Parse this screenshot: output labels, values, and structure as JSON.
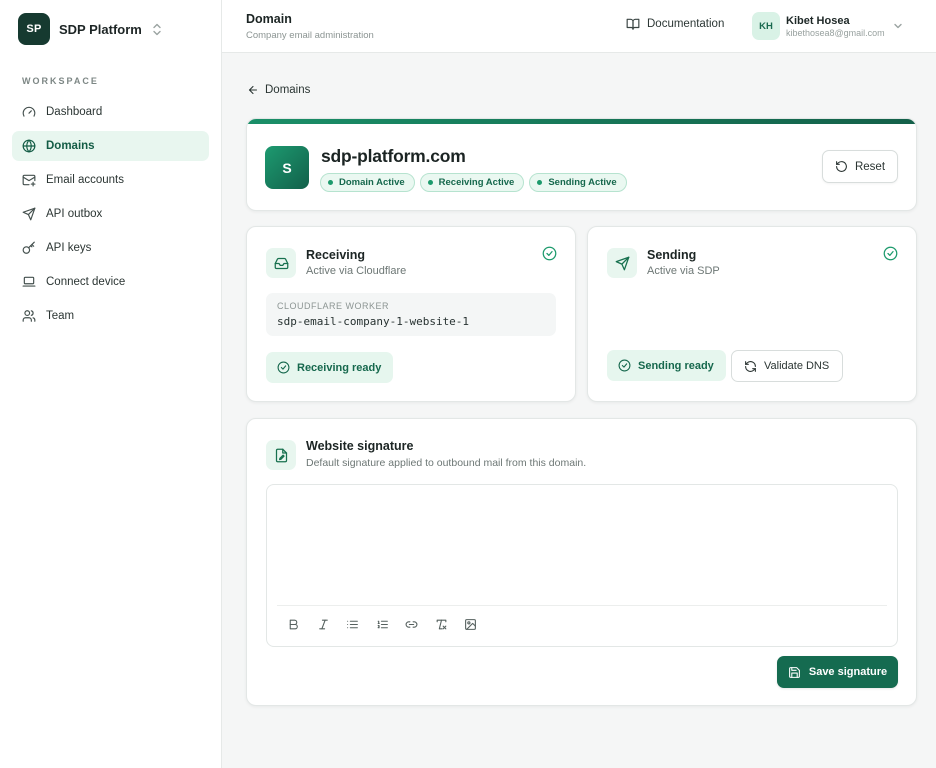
{
  "brand": {
    "logo_text": "SP",
    "name": "SDP Platform"
  },
  "sidebar": {
    "section_label": "WORKSPACE",
    "items": [
      {
        "label": "Dashboard",
        "icon": "gauge-icon",
        "active": false
      },
      {
        "label": "Domains",
        "icon": "globe-icon",
        "active": true
      },
      {
        "label": "Email accounts",
        "icon": "mail-plus-icon",
        "active": false
      },
      {
        "label": "API outbox",
        "icon": "send-icon",
        "active": false
      },
      {
        "label": "API keys",
        "icon": "key-icon",
        "active": false
      },
      {
        "label": "Connect device",
        "icon": "laptop-icon",
        "active": false
      },
      {
        "label": "Team",
        "icon": "users-icon",
        "active": false
      }
    ]
  },
  "header": {
    "title": "Domain",
    "subtitle": "Company email administration",
    "docs_label": "Documentation",
    "user": {
      "initials": "KH",
      "name": "Kibet Hosea",
      "email": "kibethosea8@gmail.com"
    }
  },
  "back_label": "Domains",
  "domain": {
    "logo_letter": "S",
    "name": "sdp-platform.com",
    "badges": [
      "Domain Active",
      "Receiving Active",
      "Sending Active"
    ],
    "reset_label": "Reset"
  },
  "receiving": {
    "title": "Receiving",
    "subtitle": "Active via Cloudflare",
    "worker_label": "CLOUDFLARE WORKER",
    "worker_value": "sdp-email-company-1-website-1",
    "status_label": "Receiving ready"
  },
  "sending": {
    "title": "Sending",
    "subtitle": "Active via SDP",
    "status_label": "Sending ready",
    "validate_label": "Validate DNS"
  },
  "signature": {
    "title": "Website signature",
    "subtitle": "Default signature applied to outbound mail from this domain.",
    "content": "",
    "save_label": "Save signature"
  },
  "colors": {
    "accent": "#156b50",
    "accent_light": "#e8f6ef",
    "success": "#1c9a6c"
  }
}
